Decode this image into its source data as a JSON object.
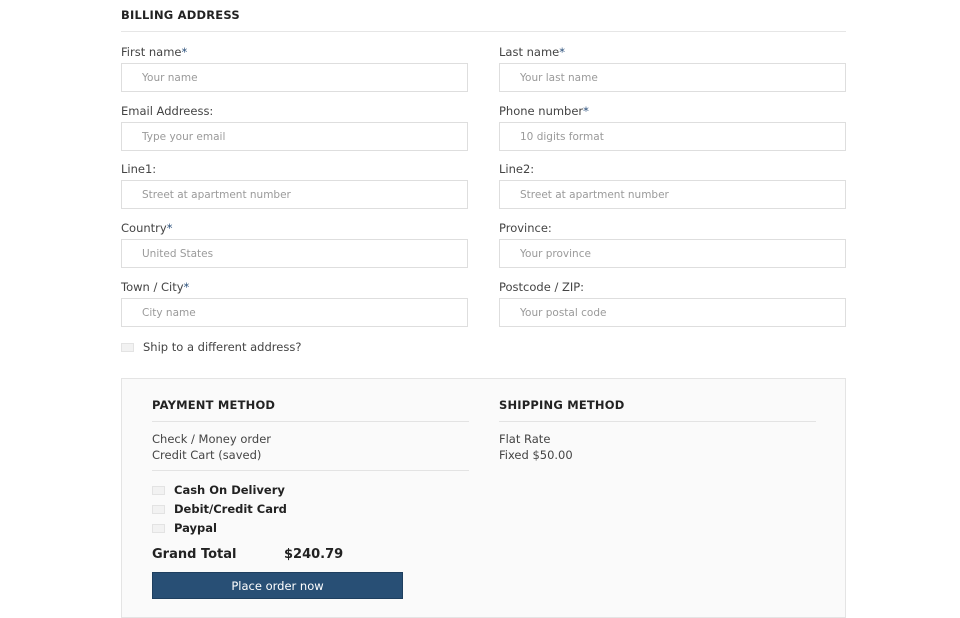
{
  "billing": {
    "title": "BILLING ADDRESS",
    "fields": {
      "first_name": {
        "label": "First name",
        "required": "*",
        "placeholder": "Your name"
      },
      "last_name": {
        "label": "Last name",
        "required": "*",
        "placeholder": "Your last name"
      },
      "email": {
        "label": "Email Addreess:",
        "placeholder": "Type your email"
      },
      "phone": {
        "label": "Phone number",
        "required": "*",
        "placeholder": "10 digits format"
      },
      "line1": {
        "label": "Line1:",
        "placeholder": "Street at apartment number"
      },
      "line2": {
        "label": "Line2:",
        "placeholder": "Street at apartment number"
      },
      "country": {
        "label": "Country",
        "required": "*",
        "placeholder": "United States"
      },
      "province": {
        "label": "Province:",
        "placeholder": "Your province"
      },
      "town": {
        "label": "Town / City",
        "required": "*",
        "placeholder": "City name"
      },
      "postcode": {
        "label": "Postcode / ZIP:",
        "placeholder": "Your postal code"
      }
    },
    "ship_different": "Ship to a different address?"
  },
  "payment": {
    "title": "PAYMENT METHOD",
    "saved_methods": [
      "Check / Money order",
      "Credit Cart (saved)"
    ],
    "options": [
      "Cash On Delivery",
      "Debit/Credit Card",
      "Paypal"
    ]
  },
  "shipping": {
    "title": "SHIPPING METHOD",
    "method": "Flat Rate",
    "price": "Fixed $50.00"
  },
  "total": {
    "label": "Grand Total",
    "value": "$240.79"
  },
  "order_button": "Place order now",
  "colors": {
    "accent": "#284f75",
    "required_mark": "#2a4f7a"
  }
}
